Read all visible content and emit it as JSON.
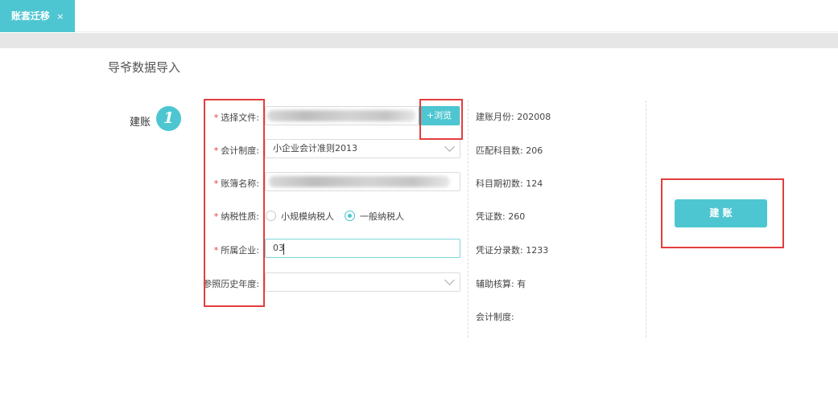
{
  "tab": {
    "label": "账套迁移",
    "close": "×"
  },
  "page": {
    "title": "导爷数据导入"
  },
  "step": {
    "label": "建账",
    "number": "1"
  },
  "form": {
    "required_mark": "*",
    "file": {
      "label": "选择文件:",
      "browse_label": "+浏览"
    },
    "accounting_system": {
      "label": "会计制度:",
      "value": "小企业会计准则2013"
    },
    "ledger_name": {
      "label": "账簿名称:"
    },
    "tax_type": {
      "label": "纳税性质:",
      "options": [
        {
          "label": "小规模纳税人",
          "checked": false
        },
        {
          "label": "一般纳税人",
          "checked": true
        }
      ]
    },
    "company": {
      "label": "所属企业:",
      "value": "03"
    },
    "history_year": {
      "label": "参照历史年度:",
      "value": ""
    }
  },
  "info": {
    "build_month": "建账月份: 202008",
    "matched_subjects": "匹配科目数: 206",
    "opening_subjects": "科目期初数: 124",
    "vouchers": "凭证数: 260",
    "voucher_entries": "凭证分录数: 1233",
    "aux_accounting": "辅助核算: 有",
    "accounting_system": "会计制度:"
  },
  "actions": {
    "build_label": "建 账"
  },
  "colors": {
    "accent": "#4dc6d1",
    "highlight": "#e43d3d",
    "required": "#e43d3d"
  }
}
